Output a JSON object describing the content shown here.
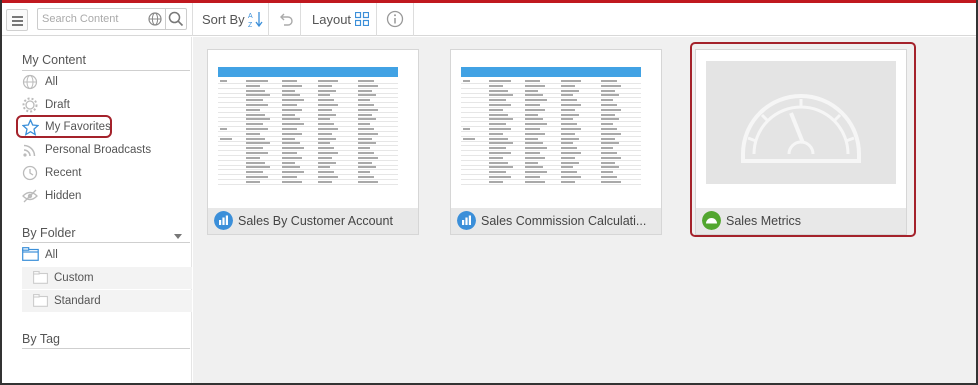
{
  "toolbar": {
    "search_placeholder": "Search Content",
    "sort_label": "Sort By",
    "layout_label": "Layout"
  },
  "sidebar": {
    "my_content_title": "My Content",
    "items": [
      {
        "label": "All",
        "icon": "globe-icon"
      },
      {
        "label": "Draft",
        "icon": "draft-gear-icon"
      },
      {
        "label": "My Favorites",
        "icon": "star-icon"
      },
      {
        "label": "Personal Broadcasts",
        "icon": "broadcast-icon"
      },
      {
        "label": "Recent",
        "icon": "clock-icon"
      },
      {
        "label": "Hidden",
        "icon": "hidden-eye-icon"
      }
    ],
    "by_folder_title": "By Folder",
    "folders": [
      {
        "label": "All",
        "icon": "folder-open-icon"
      },
      {
        "label": "Custom",
        "icon": "folder-icon"
      },
      {
        "label": "Standard",
        "icon": "folder-icon"
      }
    ],
    "by_tag_title": "By Tag"
  },
  "cards": [
    {
      "title": "Sales By Customer Account",
      "icon": "bar-chart-icon",
      "icon_color": "#3b8fd9"
    },
    {
      "title": "Sales Commission Calculati...",
      "icon": "bar-chart-icon",
      "icon_color": "#3b8fd9"
    },
    {
      "title": "Sales Metrics",
      "icon": "dashboard-gauge-icon",
      "icon_color": "#52a62f"
    }
  ],
  "colors": {
    "accent_red": "#a4222b",
    "brand_blue": "#3b8fd9",
    "table_header": "#41a2e4"
  }
}
